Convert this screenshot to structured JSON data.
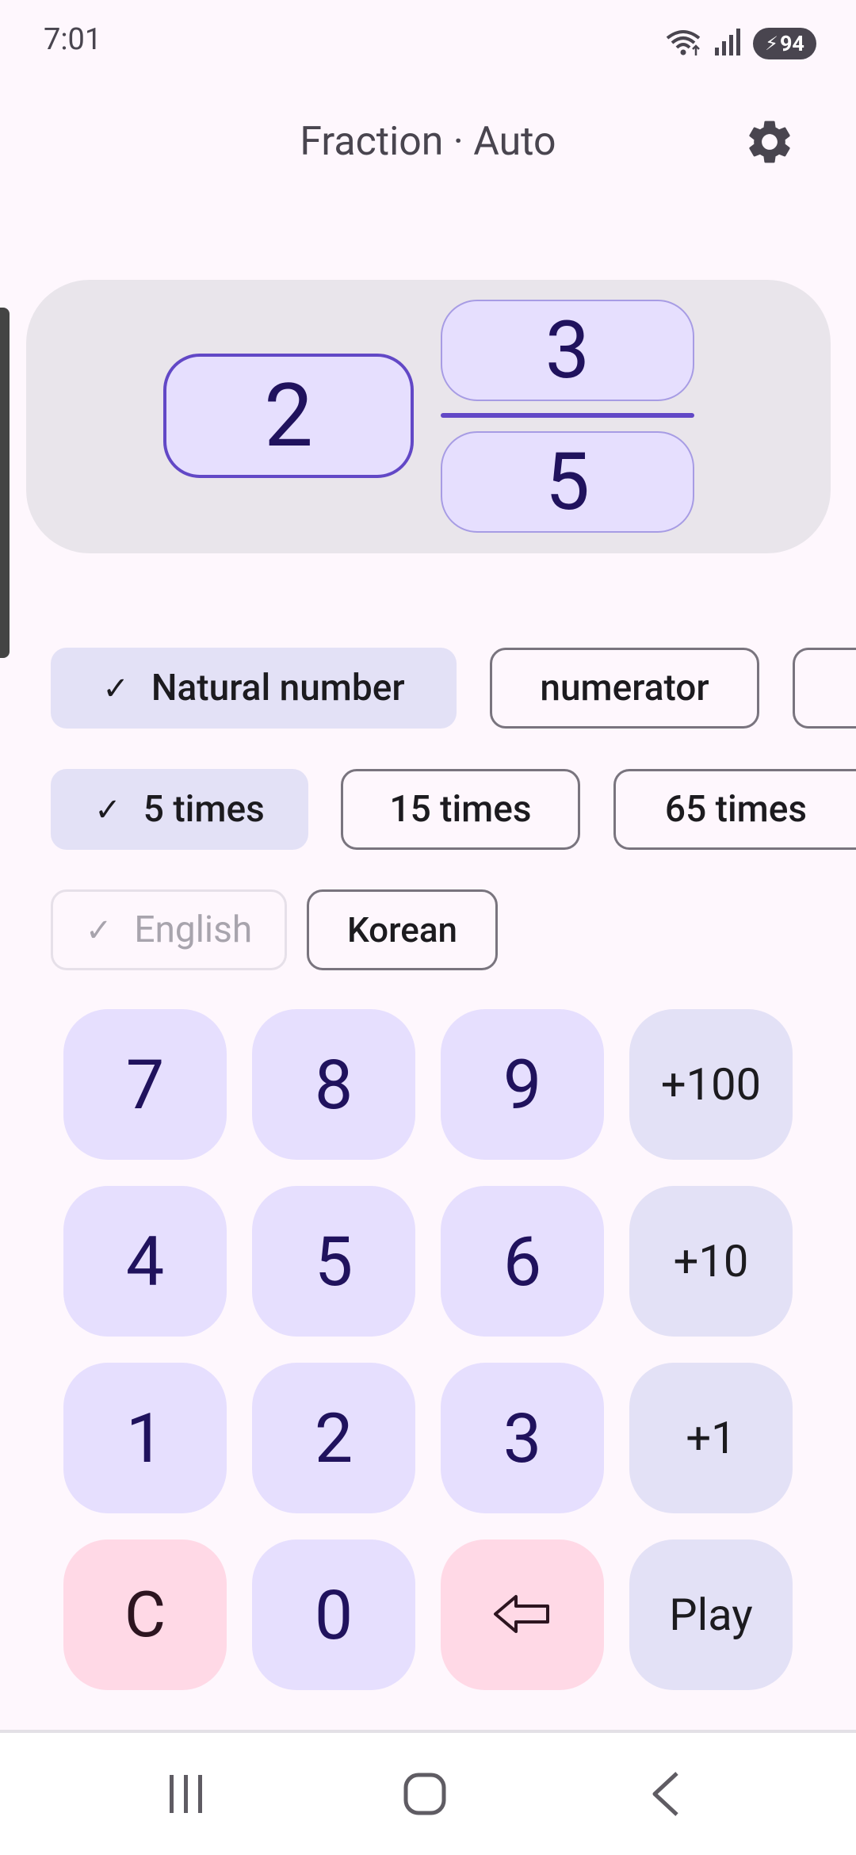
{
  "status": {
    "time": "7:01",
    "battery": "94"
  },
  "header": {
    "title": "Fraction · Auto"
  },
  "fraction": {
    "whole": "2",
    "numerator": "3",
    "denominator": "5"
  },
  "mode_chips": [
    {
      "label": "Natural number",
      "selected": true
    },
    {
      "label": "numerator",
      "selected": false
    }
  ],
  "count_chips": [
    {
      "label": "5 times",
      "selected": true
    },
    {
      "label": "15 times",
      "selected": false
    },
    {
      "label": "65 times",
      "selected": false
    }
  ],
  "language_chips": [
    {
      "label": "English",
      "selected": true,
      "disabled": true
    },
    {
      "label": "Korean",
      "selected": false
    }
  ],
  "keypad": {
    "k7": "7",
    "k8": "8",
    "k9": "9",
    "plus100": "+100",
    "k4": "4",
    "k5": "5",
    "k6": "6",
    "plus10": "+10",
    "k1": "1",
    "k2": "2",
    "k3": "3",
    "plus1": "+1",
    "clear": "C",
    "k0": "0",
    "backspace": "⇦",
    "play": "Play"
  },
  "colors": {
    "accent": "#6248C6",
    "key_bg": "#E6DFFE",
    "danger_bg": "#FFD9E6",
    "background": "#FEF7FD"
  }
}
